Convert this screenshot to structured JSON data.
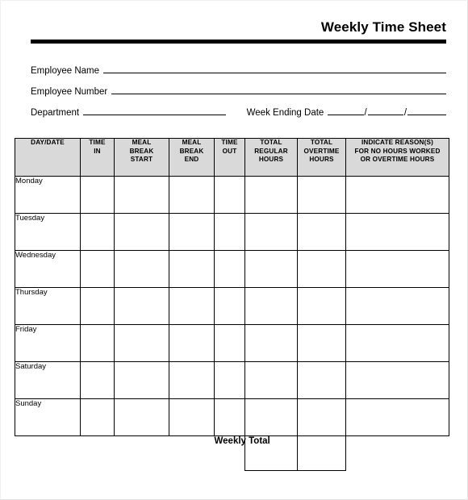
{
  "document": {
    "title": "Weekly Time Sheet"
  },
  "form_fields": [
    {
      "label": "Employee Name",
      "value": ""
    },
    {
      "label": "Employee Number",
      "value": ""
    },
    {
      "label": "Department",
      "value": ""
    }
  ],
  "week_ending": {
    "label": "Week Ending Date",
    "separator": "/",
    "month": "",
    "day": "",
    "year": ""
  },
  "table": {
    "columns": [
      "DAY/DATE",
      "TIME IN",
      "MEAL BREAK START",
      "MEAL BREAK END",
      "TIME OUT",
      "TOTAL REGULAR HOURS",
      "TOTAL OVERTIME HOURS",
      "INDICATE REASON(S) FOR NO HOURS WORKED OR OVERTIME HOURS"
    ],
    "column_lines": [
      [
        "DAY/DATE"
      ],
      [
        "TIME",
        "IN"
      ],
      [
        "MEAL",
        "BREAK",
        "START"
      ],
      [
        "MEAL",
        "BREAK",
        "END"
      ],
      [
        "TIME",
        "OUT"
      ],
      [
        "TOTAL",
        "REGULAR",
        "HOURS"
      ],
      [
        "TOTAL",
        "OVERTIME",
        "HOURS"
      ],
      [
        "INDICATE REASON(S)",
        "FOR NO HOURS WORKED",
        "OR OVERTIME HOURS"
      ]
    ],
    "rows": [
      {
        "day": "Monday",
        "time_in": "",
        "meal_break_start": "",
        "meal_break_end": "",
        "time_out": "",
        "total_regular_hours": "",
        "total_overtime_hours": "",
        "reason": ""
      },
      {
        "day": "Tuesday",
        "time_in": "",
        "meal_break_start": "",
        "meal_break_end": "",
        "time_out": "",
        "total_regular_hours": "",
        "total_overtime_hours": "",
        "reason": ""
      },
      {
        "day": "Wednesday",
        "time_in": "",
        "meal_break_start": "",
        "meal_break_end": "",
        "time_out": "",
        "total_regular_hours": "",
        "total_overtime_hours": "",
        "reason": ""
      },
      {
        "day": "Thursday",
        "time_in": "",
        "meal_break_start": "",
        "meal_break_end": "",
        "time_out": "",
        "total_regular_hours": "",
        "total_overtime_hours": "",
        "reason": ""
      },
      {
        "day": "Friday",
        "time_in": "",
        "meal_break_start": "",
        "meal_break_end": "",
        "time_out": "",
        "total_regular_hours": "",
        "total_overtime_hours": "",
        "reason": ""
      },
      {
        "day": "Saturday",
        "time_in": "",
        "meal_break_start": "",
        "meal_break_end": "",
        "time_out": "",
        "total_regular_hours": "",
        "total_overtime_hours": "",
        "reason": ""
      },
      {
        "day": "Sunday",
        "time_in": "",
        "meal_break_start": "",
        "meal_break_end": "",
        "time_out": "",
        "total_regular_hours": "",
        "total_overtime_hours": "",
        "reason": ""
      }
    ],
    "total_row": {
      "label": "Weekly Total",
      "total_regular_hours": "",
      "total_overtime_hours": ""
    }
  },
  "colors": {
    "header_fill": "#d9d9d9",
    "rule": "#000000",
    "page_border": "#e3e3e3",
    "text": "#000000"
  }
}
